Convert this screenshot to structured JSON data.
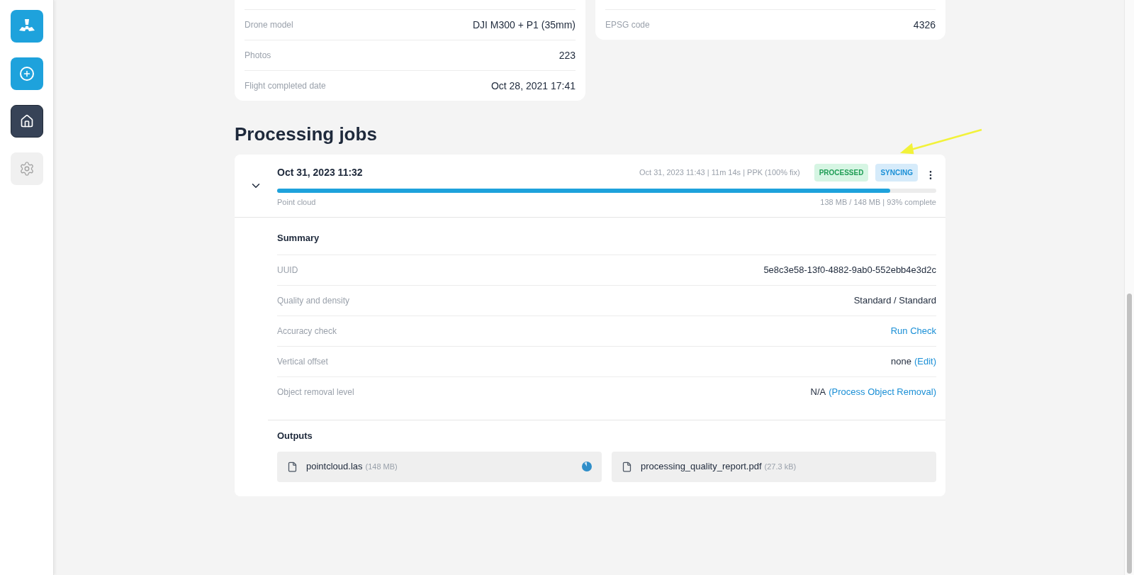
{
  "sidebar": {
    "items": [
      {
        "kind": "logo",
        "selected": false
      },
      {
        "kind": "add",
        "selected": false
      },
      {
        "kind": "home",
        "selected": true
      },
      {
        "kind": "settings",
        "selected": false
      }
    ]
  },
  "flight_card": {
    "rows": [
      {
        "label": "Drone model",
        "value": "DJI M300 + P1 (35mm)"
      },
      {
        "label": "Photos",
        "value": "223"
      },
      {
        "label": "Flight completed date",
        "value": "Oct 28, 2021 17:41"
      }
    ]
  },
  "coordinate_card": {
    "rows": [
      {
        "label": "EPSG code",
        "value": "4326"
      }
    ]
  },
  "processing_jobs": {
    "title": "Processing jobs",
    "jobs": [
      {
        "expanded": true,
        "title": "Oct 31, 2023 11:32",
        "meta": "Oct 31, 2023 11:43 | 11m 14s | PPK (100% fix)",
        "badges": [
          {
            "label": "PROCESSED",
            "kind": "success"
          },
          {
            "label": "SYNCING",
            "kind": "info"
          }
        ],
        "progress": {
          "label": "Point cloud",
          "reading": "138 MB / 148 MB | 93% complete",
          "level": 0.93
        },
        "summary": {
          "title": "Summary",
          "rows": [
            {
              "label": "UUID",
              "value": "5e8c3e58-13f0-4882-9ab0-552ebb4e3d2c"
            },
            {
              "label": "Quality and density",
              "value": "Standard / Standard"
            },
            {
              "label": "Accuracy check",
              "link": "Run Check"
            },
            {
              "label": "Vertical offset",
              "value": "none",
              "link": "(Edit)"
            },
            {
              "label": "Object removal level",
              "value": "N/A",
              "link": "(Process Object Removal)"
            }
          ]
        },
        "outputs": {
          "title": "Outputs",
          "files": [
            {
              "name": "pointcloud.las",
              "size": "(148 MB)",
              "syncing": true
            },
            {
              "name": "processing_quality_report.pdf",
              "size": "(27.3 kB)",
              "syncing": false
            }
          ]
        }
      }
    ]
  }
}
